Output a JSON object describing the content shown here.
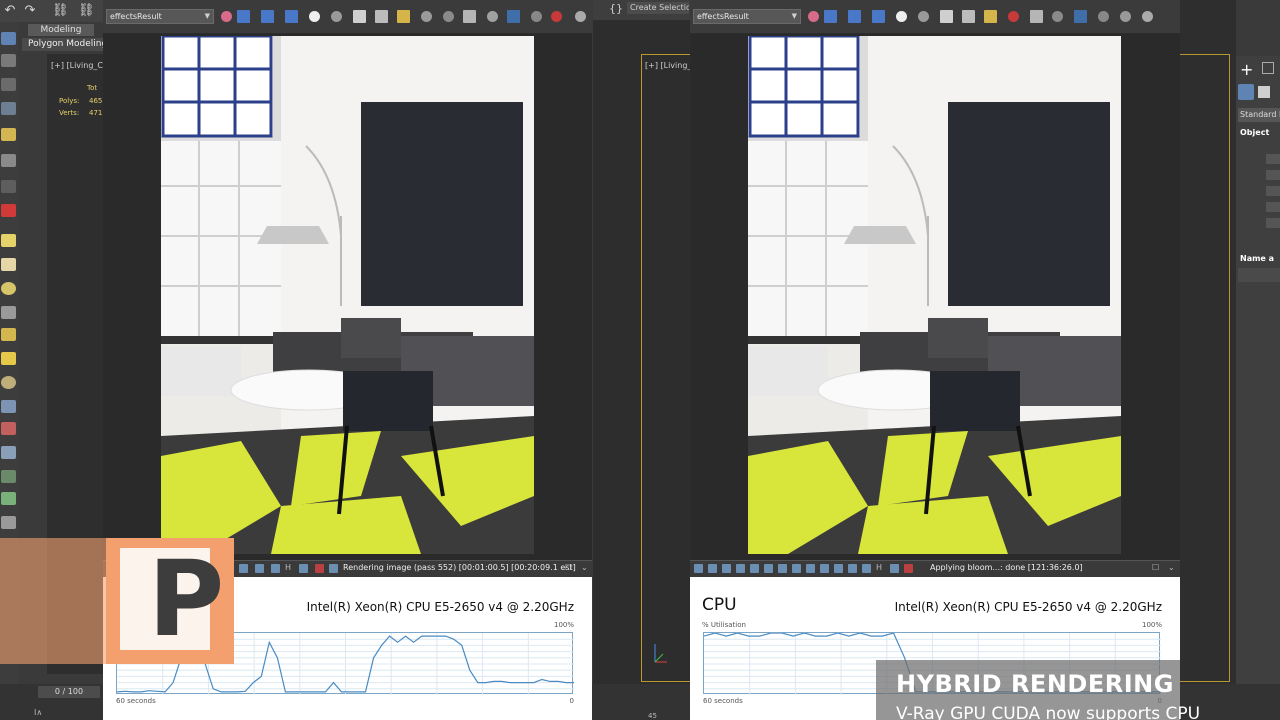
{
  "left_viewport": {
    "mode_tab": "Modeling",
    "mode_sub": "Polygon Modeling",
    "vp_label": "[+] [Living_C",
    "stats": {
      "total": "Tot",
      "polys_label": "Polys:",
      "polys_val": "465",
      "verts_label": "Verts:",
      "verts_val": "471"
    }
  },
  "frame_buffer_left": {
    "channel": "effectsResult",
    "status": "Rendering image (pass 552) [00:01:00.5] [00:20:09.1 est]",
    "cpu_name": "Intel(R) Xeon(R) CPU E5-2650 v4 @ 2.20GHz",
    "axis_max": "100%",
    "axis_left": "60 seconds",
    "axis_right": "0"
  },
  "frame_buffer_right": {
    "channel": "effectsResult",
    "status": "Applying bloom...: done [121:36:26.0]",
    "cpu_title": "CPU",
    "util_label": "% Utilisation",
    "cpu_name": "Intel(R) Xeon(R) CPU E5-2650 v4 @ 2.20GHz",
    "axis_max": "100%",
    "axis_left": "60 seconds",
    "axis_right": "0"
  },
  "mid_viewport": {
    "create_selection": "Create Selection",
    "vp_label": "[+] [Living_"
  },
  "command_panel": {
    "dropdown": "Standard P",
    "section1": "Object",
    "section2": "Name a"
  },
  "timeline": {
    "frame_counter": "0 / 100",
    "tick": "45"
  },
  "overlay": {
    "logo_letter": "P",
    "title": "HYBRID RENDERING",
    "subtitle": "V-Ray GPU CUDA now supports CPU"
  },
  "cpu_graph_left": [
    5,
    6,
    5,
    5,
    7,
    6,
    5,
    20,
    60,
    95,
    90,
    50,
    10,
    5,
    5,
    5,
    6,
    20,
    30,
    85,
    60,
    5,
    5,
    5,
    5,
    5,
    5,
    20,
    5,
    5,
    5,
    5,
    60,
    80,
    95,
    85,
    95,
    85,
    95,
    95,
    95,
    95,
    90,
    80,
    40,
    20,
    20,
    22,
    22,
    20,
    20,
    20,
    20,
    25,
    22,
    22,
    20,
    20
  ],
  "cpu_graph_right": [
    95,
    100,
    95,
    100,
    95,
    95,
    100,
    100,
    95,
    100,
    95,
    95,
    100,
    95,
    100,
    95,
    95,
    100,
    60,
    5,
    5,
    5,
    5,
    5,
    5,
    5,
    5,
    5,
    5,
    5,
    5,
    5,
    5,
    5,
    5,
    5,
    5,
    5,
    5,
    5,
    5,
    5
  ]
}
